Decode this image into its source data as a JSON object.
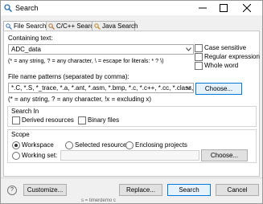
{
  "window": {
    "title": "Search"
  },
  "tabs": [
    {
      "label": "File Search",
      "active": true
    },
    {
      "label": "C/C++ Search",
      "active": false
    },
    {
      "label": "Java Search",
      "active": false
    }
  ],
  "containing_text": {
    "label": "Containing text:",
    "value": "ADC_data",
    "hint": "(* = any string, ? = any character, \\ = escape for literals: * ? \\)"
  },
  "options": {
    "case_sensitive": "Case sensitive",
    "regular_expression": "Regular expression",
    "whole_word": "Whole word"
  },
  "file_patterns": {
    "label": "File name patterns (separated by comma):",
    "value": "*.C, *.S, *_trace, *.a, *.ant, *.asm, *.bmp, *.c, *.c++, *.cc, *.class, *.",
    "choose_button": "Choose...",
    "hint": "(* = any string, ? = any character, !x = excluding x)"
  },
  "search_in": {
    "title": "Search In",
    "derived_resources": "Derived resources",
    "binary_files": "Binary files"
  },
  "scope": {
    "title": "Scope",
    "workspace": "Workspace",
    "selected_resources": "Selected resources",
    "enclosing_projects": "Enclosing projects",
    "working_set": "Working set:",
    "working_set_value": "",
    "choose_button": "Choose...",
    "selected": "workspace"
  },
  "buttons": {
    "customize": "Customize...",
    "replace": "Replace...",
    "search": "Search",
    "cancel": "Cancel"
  },
  "behind_text": "s = timerdemo c",
  "colors": {
    "focus_border": "#0078d7",
    "accent": "#0078d7"
  }
}
